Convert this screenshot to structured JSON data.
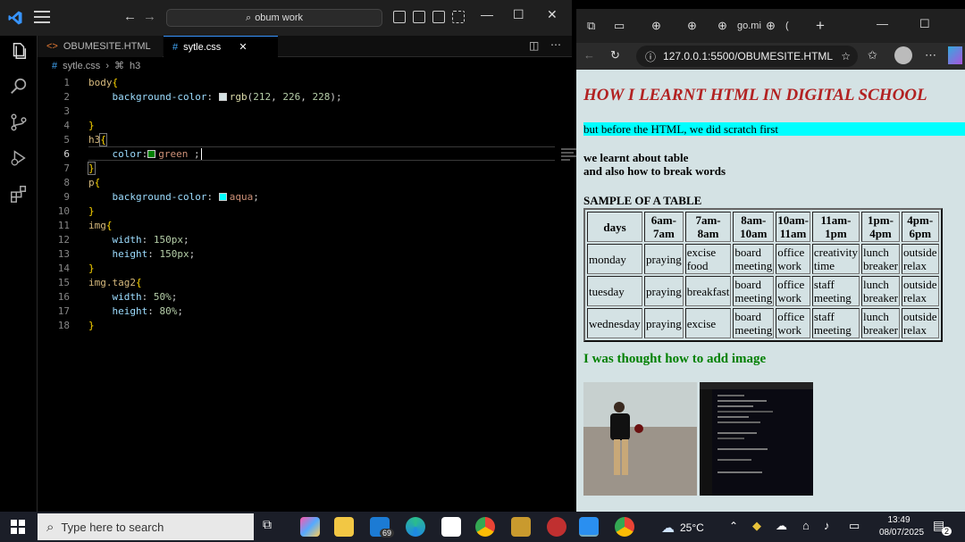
{
  "vscode": {
    "search": "obum work",
    "tabs": [
      {
        "label": "OBUMESITE.HTML"
      },
      {
        "label": "sytle.css"
      }
    ],
    "breadcrumb": {
      "file": "sytle.css",
      "symbol": "h3"
    },
    "code_lines": [
      {
        "n": "1",
        "text": "body{"
      },
      {
        "n": "2",
        "text": "background-color: rgb(212, 226, 228);"
      },
      {
        "n": "3",
        "text": ""
      },
      {
        "n": "4",
        "text": "}"
      },
      {
        "n": "5",
        "text": "h3{"
      },
      {
        "n": "6",
        "text": "color: green ;"
      },
      {
        "n": "7",
        "text": "}"
      },
      {
        "n": "8",
        "text": "p{"
      },
      {
        "n": "9",
        "text": "background-color: aqua;"
      },
      {
        "n": "10",
        "text": "}"
      },
      {
        "n": "11",
        "text": "img{"
      },
      {
        "n": "12",
        "text": "width: 150px;"
      },
      {
        "n": "13",
        "text": "height: 150px;"
      },
      {
        "n": "14",
        "text": "}"
      },
      {
        "n": "15",
        "text": "img.tag2{"
      },
      {
        "n": "16",
        "text": "width: 50%;"
      },
      {
        "n": "17",
        "text": "height: 80%;"
      },
      {
        "n": "18",
        "text": "}"
      }
    ],
    "colors": {
      "accent": "#3794ff",
      "swatch_bg": "#d4e2e4",
      "swatch_green": "#008000",
      "swatch_aqua": "#00ffff"
    }
  },
  "browser": {
    "tabs": [
      {
        "label": "go.mi"
      },
      {
        "label": "("
      }
    ],
    "url": "127.0.0.1:5500/OBUMESITE.HTML",
    "page": {
      "heading": "HOW I LEARNT HTML IN DIGITAL SCHOOL",
      "para1": "but before the HTML, we did scratch first",
      "para2_line1": "we learnt about table",
      "para2_line2": "and also how to break words",
      "table_caption": "SAMPLE OF A TABLE",
      "table_headers": [
        "days",
        "6am-7am",
        "7am-8am",
        "8am-10am",
        "10am-11am",
        "11am-1pm",
        "1pm-4pm",
        "4pm-6pm"
      ],
      "table_rows": [
        [
          "monday",
          "praying",
          "excise food",
          "board meeting",
          "office work",
          "creativity time",
          "lunch breaker",
          "outside relax"
        ],
        [
          "tuesday",
          "praying",
          "breakfast",
          "board meeting",
          "office work",
          "staff meeting",
          "lunch breaker",
          "outside relax"
        ],
        [
          "wednesday",
          "praying",
          "excise",
          "board meeting",
          "office work",
          "staff meeting",
          "lunch breaker",
          "outside relax"
        ]
      ],
      "image_heading": "I was thought how to add image"
    }
  },
  "taskbar": {
    "search_placeholder": "Type here to search",
    "mail_badge": "69",
    "weather": "25°C",
    "time": "13:49",
    "date": "08/07/2025",
    "notification_count": "2"
  }
}
